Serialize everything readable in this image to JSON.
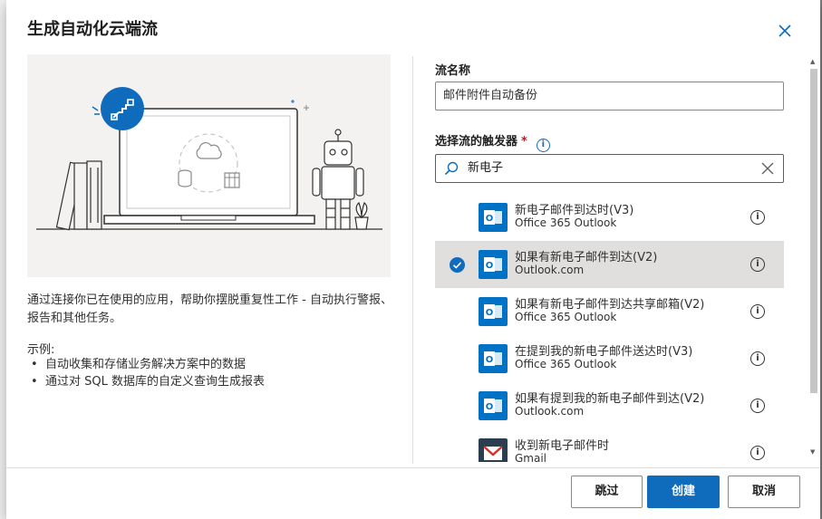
{
  "dialog": {
    "title": "生成自动化云端流",
    "description": "通过连接你已在使用的应用，帮助你摆脱重复性工作 - 自动执行警报、报告和其他任务。",
    "examples_title": "示例:",
    "examples": [
      "自动收集和存储业务解决方案中的数据",
      "通过对 SQL 数据库的自定义查询生成报表"
    ]
  },
  "form": {
    "flow_name_label": "流名称",
    "flow_name_value": "邮件附件自动备份",
    "trigger_label": "选择流的触发器",
    "required_mark": "*",
    "search_value": "新电子"
  },
  "triggers": [
    {
      "title": "新电子邮件到达时(V3)",
      "connector": "Office 365 Outlook",
      "icon": "outlook-icon",
      "selected": false
    },
    {
      "title": "如果有新电子邮件到达(V2)",
      "connector": "Outlook.com",
      "icon": "outlook-icon",
      "selected": true
    },
    {
      "title": "如果有新电子邮件到达共享邮箱(V2)",
      "connector": "Office 365 Outlook",
      "icon": "outlook-icon",
      "selected": false
    },
    {
      "title": "在提到我的新电子邮件送达时(V3)",
      "connector": "Office 365 Outlook",
      "icon": "outlook-icon",
      "selected": false
    },
    {
      "title": "如果有提到我的新电子邮件到达(V2)",
      "connector": "Outlook.com",
      "icon": "outlook-icon",
      "selected": false
    },
    {
      "title": "收到新电子邮件时",
      "connector": "Gmail",
      "icon": "gmail-icon",
      "selected": false
    }
  ],
  "footer": {
    "back_label": "跳过",
    "create_label": "创建",
    "cancel_label": "取消"
  },
  "colors": {
    "accent": "#0f6cbd",
    "selected_row": "#e1dfdd",
    "outlook": "#0072c6"
  }
}
